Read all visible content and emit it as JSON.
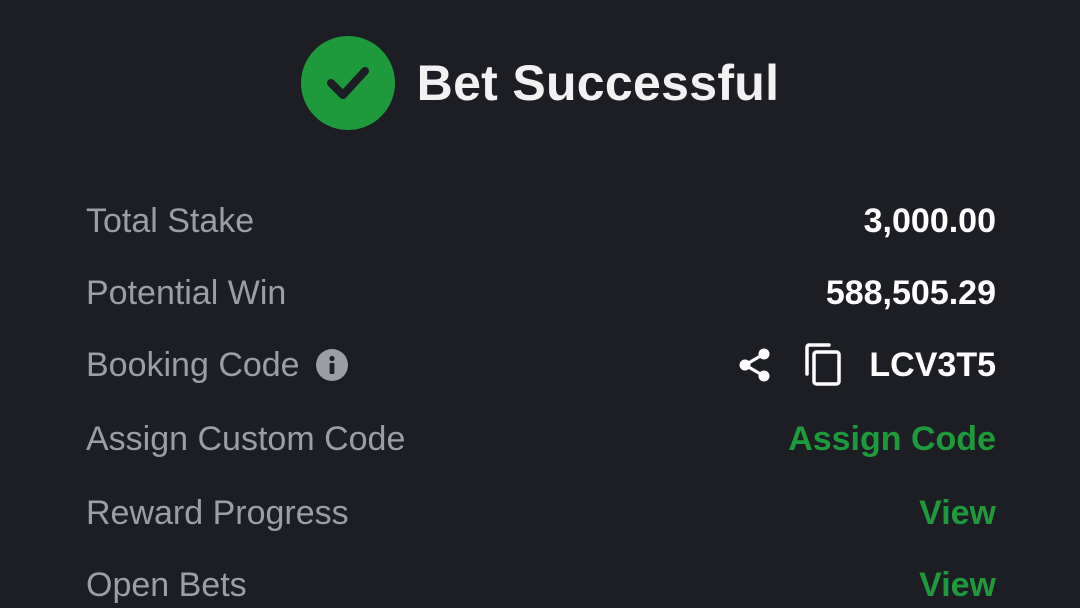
{
  "header": {
    "title": "Bet Successful",
    "accent_color": "#1e9a3c"
  },
  "rows": {
    "total_stake": {
      "label": "Total Stake",
      "value": "3,000.00"
    },
    "potential_win": {
      "label": "Potential Win",
      "value": "588,505.29"
    },
    "booking_code": {
      "label": "Booking Code",
      "value": "LCV3T5",
      "icons": [
        "info-icon",
        "share-icon",
        "copy-icon"
      ]
    },
    "assign_custom_code": {
      "label": "Assign Custom Code",
      "action": "Assign Code"
    },
    "reward_progress": {
      "label": "Reward Progress",
      "action": "View"
    },
    "open_bets": {
      "label": "Open Bets",
      "action": "View"
    }
  }
}
